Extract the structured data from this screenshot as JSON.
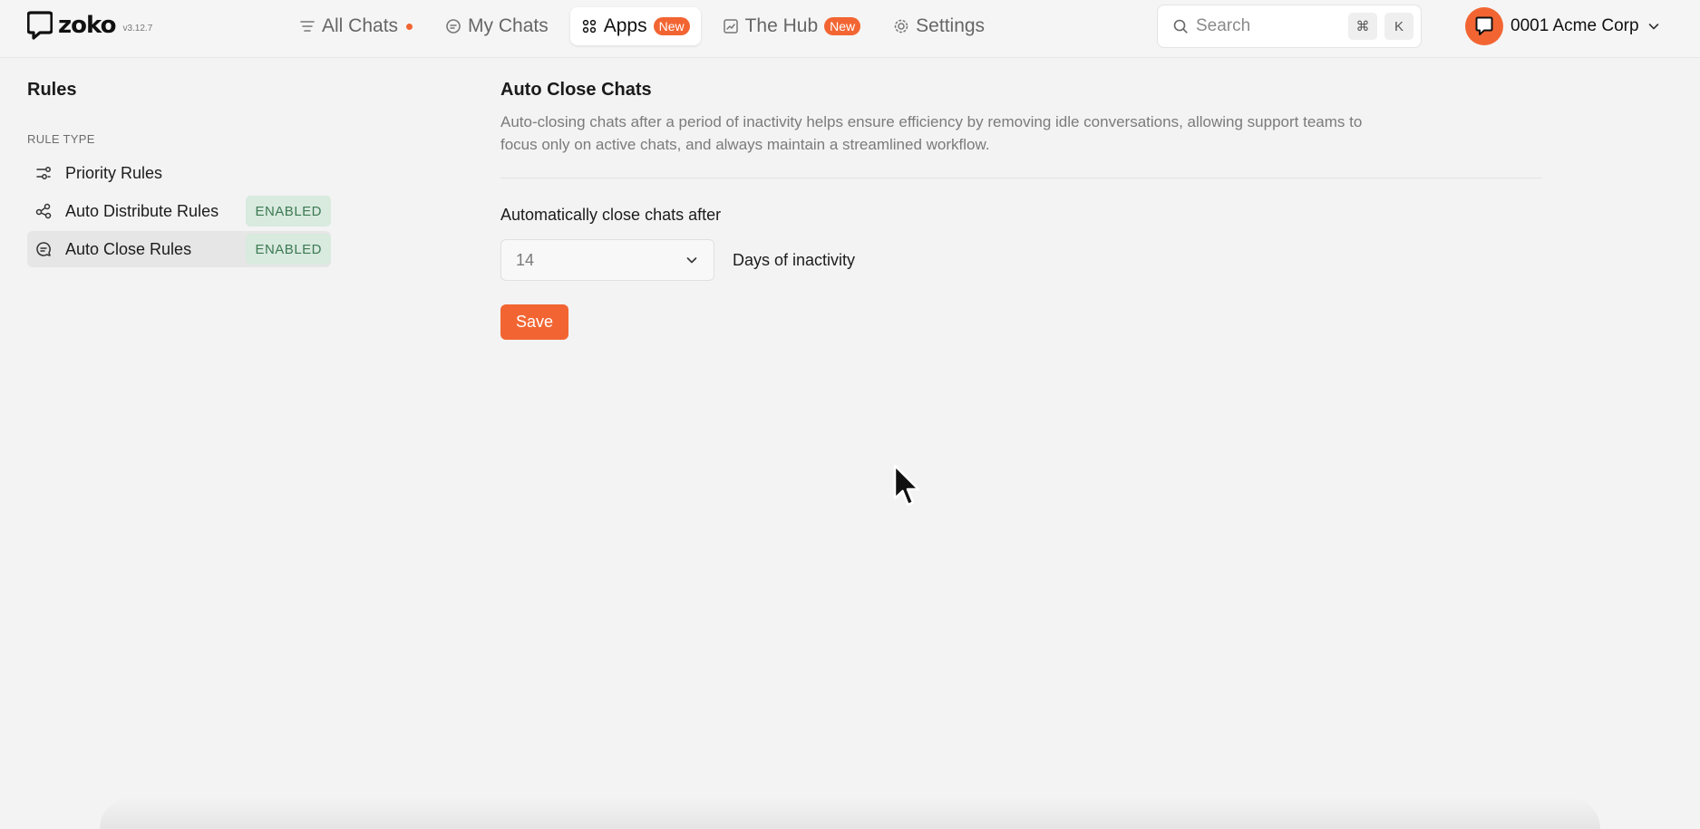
{
  "app": {
    "name": "zoko",
    "version": "v3.12.7"
  },
  "nav": {
    "items": [
      {
        "label": "All Chats",
        "icon": "list-filter-icon",
        "dot": true
      },
      {
        "label": "My Chats",
        "icon": "chat-bubble-icon"
      },
      {
        "label": "Apps",
        "icon": "grid-icon",
        "badge": "New",
        "active": true
      },
      {
        "label": "The Hub",
        "icon": "chart-icon",
        "badge": "New"
      },
      {
        "label": "Settings",
        "icon": "gear-icon"
      }
    ]
  },
  "search": {
    "placeholder": "Search",
    "shortcut_keys": [
      "⌘",
      "K"
    ]
  },
  "account": {
    "name": "0001 Acme Corp"
  },
  "sidebar": {
    "title": "Rules",
    "section_label": "RULE TYPE",
    "items": [
      {
        "label": "Priority Rules",
        "icon": "sliders-icon"
      },
      {
        "label": "Auto Distribute Rules",
        "icon": "share-nodes-icon",
        "status": "ENABLED"
      },
      {
        "label": "Auto Close Rules",
        "icon": "chat-close-icon",
        "status": "ENABLED",
        "selected": true
      }
    ]
  },
  "main": {
    "title": "Auto Close Chats",
    "description": "Auto-closing chats after a period of inactivity helps ensure efficiency by removing idle conversations, allowing support teams to focus only on active chats, and always maintain a streamlined workflow.",
    "field_label": "Automatically close chats after",
    "select_value": "14",
    "field_suffix": "Days of inactivity",
    "save_label": "Save"
  },
  "colors": {
    "accent": "#f26532",
    "enabled_bg": "#d9eadf",
    "enabled_text": "#3c7a53"
  }
}
